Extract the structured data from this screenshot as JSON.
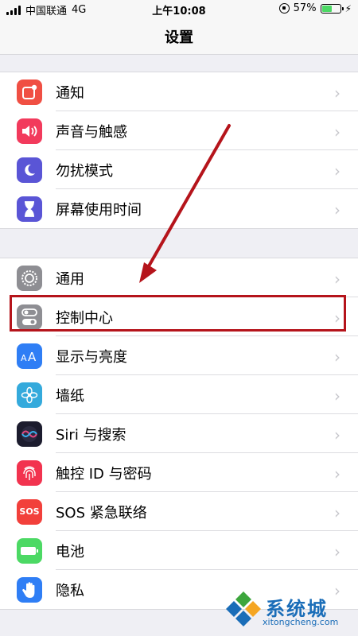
{
  "status": {
    "carrier": "中国联通",
    "network": "4G",
    "time": "上午10:08",
    "battery_percent_text": "57%",
    "battery_level": 0.57
  },
  "nav": {
    "title": "设置"
  },
  "groups": [
    {
      "items": [
        {
          "label": "通知",
          "icon": "notifications-icon",
          "color": "#f04f43"
        },
        {
          "label": "声音与触感",
          "icon": "sound-icon",
          "color": "#f23a5c"
        },
        {
          "label": "勿扰模式",
          "icon": "moon-icon",
          "color": "#5a55d6"
        },
        {
          "label": "屏幕使用时间",
          "icon": "hourglass-icon",
          "color": "#5a55d6"
        }
      ]
    },
    {
      "items": [
        {
          "label": "通用",
          "icon": "gear-icon",
          "color": "#8e8e93"
        },
        {
          "label": "控制中心",
          "icon": "toggles-icon",
          "color": "#8e8e93"
        },
        {
          "label": "显示与亮度",
          "icon": "text-size-icon",
          "color": "#2f7ef5"
        },
        {
          "label": "墙纸",
          "icon": "flower-icon",
          "color": "#34aadc"
        },
        {
          "label": "Siri 与搜索",
          "icon": "siri-icon",
          "color": "#1c1c2e"
        },
        {
          "label": "触控 ID 与密码",
          "icon": "fingerprint-icon",
          "color": "#f2334f"
        },
        {
          "label": "SOS 紧急联络",
          "icon": "sos-icon",
          "color": "#f2403b"
        },
        {
          "label": "电池",
          "icon": "battery-icon",
          "color": "#4cd964"
        },
        {
          "label": "隐私",
          "icon": "hand-icon",
          "color": "#2f7ef5"
        }
      ]
    }
  ],
  "watermark": {
    "text": "系统城",
    "url": "xitongcheng.com"
  },
  "annotation_color": "#b5141b"
}
